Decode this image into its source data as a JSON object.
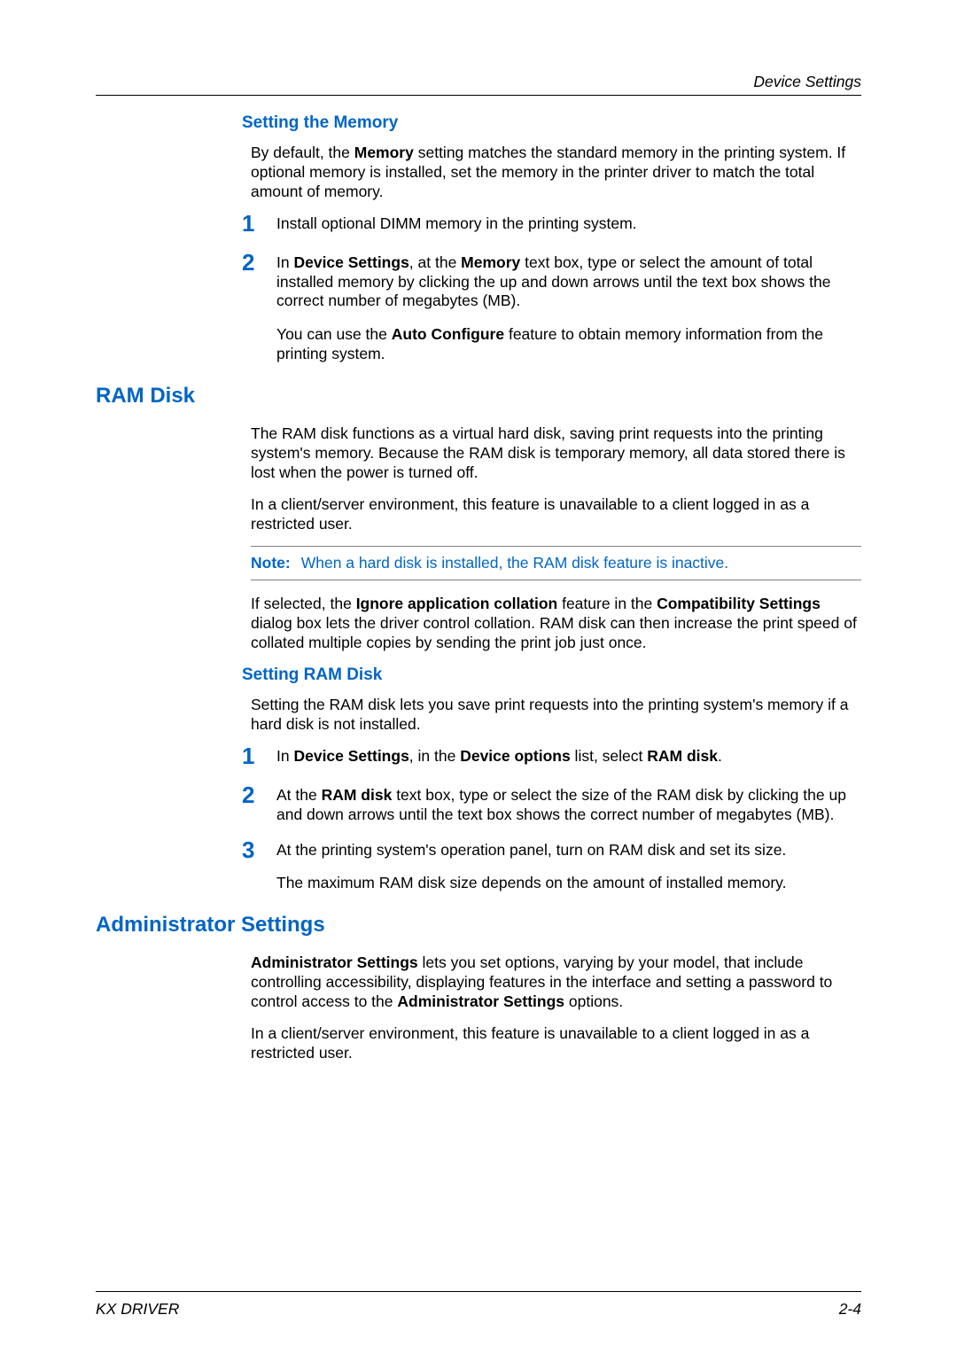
{
  "header": {
    "section_label": "Device Settings"
  },
  "s1": {
    "heading": "Setting the Memory",
    "intro_pre": "By default, the ",
    "intro_b1": "Memory",
    "intro_post": " setting matches the standard memory in the printing system. If optional memory is installed, set the memory in the printer driver to match the total amount of memory.",
    "step1": "Install optional DIMM memory in the printing system.",
    "step2_pre": "In ",
    "step2_b1": "Device Settings",
    "step2_mid": ", at the ",
    "step2_b2": "Memory",
    "step2_post": " text box, type or select the amount of total installed memory by clicking the up and down arrows until the text box shows the correct number of megabytes (MB).",
    "step2_p2_pre": "You can use the ",
    "step2_p2_b": "Auto Configure",
    "step2_p2_post": " feature to obtain memory information from the printing system."
  },
  "s2": {
    "heading": "RAM Disk",
    "p1": "The RAM disk functions as a virtual hard disk, saving print requests into the printing system's memory. Because the RAM disk is temporary memory, all data stored there is lost when the power is turned off.",
    "p2": "In a client/server environment, this feature is unavailable to a client logged in as a restricted user.",
    "note_label": "Note:",
    "note_text": "When a hard disk is installed, the RAM disk feature is inactive.",
    "p3_pre": "If selected, the ",
    "p3_b1": "Ignore application collation",
    "p3_mid": " feature in the ",
    "p3_b2": "Compatibility Settings",
    "p3_post": " dialog box lets the driver control collation. RAM disk can then increase the print speed of collated multiple copies by sending the print job just once."
  },
  "s3": {
    "heading": "Setting RAM Disk",
    "p1": "Setting the RAM disk lets you save print requests into the printing system's memory if a hard disk is not installed.",
    "step1_pre": "In ",
    "step1_b1": "Device Settings",
    "step1_mid": ", in the ",
    "step1_b2": "Device options",
    "step1_mid2": " list, select ",
    "step1_b3": "RAM disk",
    "step1_post": ".",
    "step2_pre": "At the ",
    "step2_b1": "RAM disk",
    "step2_post": " text box, type or select the size of the RAM disk by clicking the up and down arrows until the text box shows the correct number of megabytes (MB).",
    "step3": "At the printing system's operation panel, turn on RAM disk and set its size.",
    "step3_p2": "The maximum RAM disk size depends on the amount of installed memory."
  },
  "s4": {
    "heading": "Administrator Settings",
    "p1_b": "Administrator Settings",
    "p1_mid": " lets you set options, varying by your model, that include controlling accessibility, displaying features in the interface and setting a password to control access to the ",
    "p1_b2": "Administrator Settings",
    "p1_post": " options.",
    "p2": "In a client/server environment, this feature is unavailable to a client logged in as a restricted user."
  },
  "footer": {
    "left": "KX DRIVER",
    "right": "2-4"
  },
  "nums": {
    "n1": "1",
    "n2": "2",
    "n3": "3"
  }
}
